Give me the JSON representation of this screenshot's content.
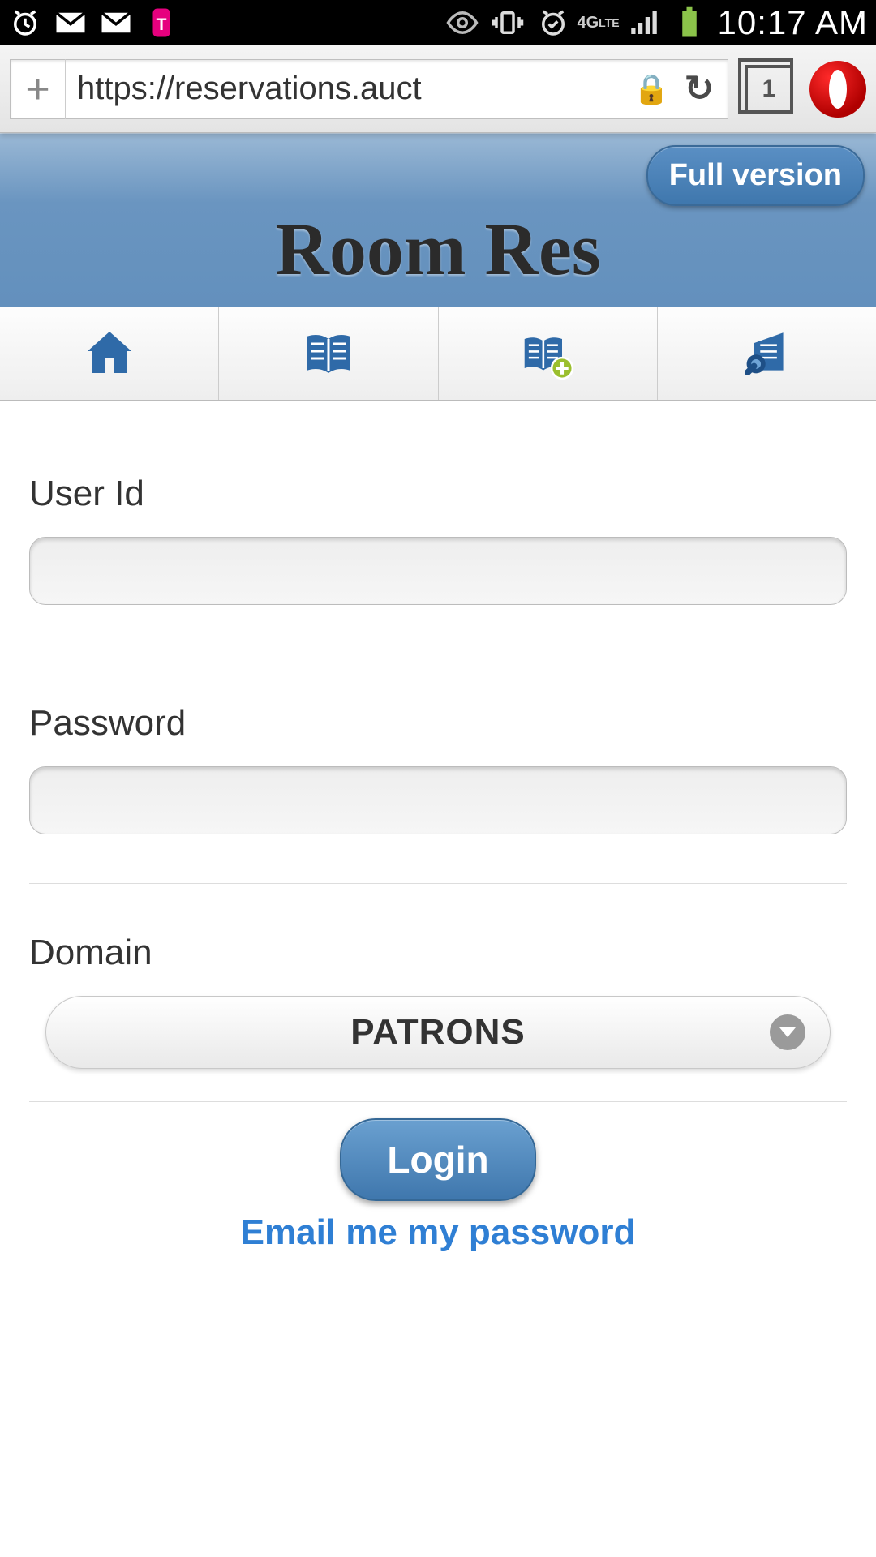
{
  "status_bar": {
    "time": "10:17 AM",
    "tab_count": "1",
    "icons_left": [
      "alarm",
      "gmail",
      "gmail",
      "tmobile"
    ],
    "icons_right": [
      "eye",
      "mute",
      "alarm-check",
      "4g-lte",
      "signal",
      "battery"
    ]
  },
  "browser": {
    "url": "https://reservations.auct",
    "new_tab_glyph": "+",
    "lock_glyph": "🔒",
    "reload_glyph": "↻"
  },
  "header": {
    "title": "Room Res",
    "full_version_label": "Full version"
  },
  "tabs": {
    "items": [
      "home",
      "reservations",
      "new-reservation",
      "search-rooms"
    ]
  },
  "form": {
    "user_id_label": "User Id",
    "user_id_value": "",
    "password_label": "Password",
    "password_value": "",
    "domain_label": "Domain",
    "domain_value": "PATRONS",
    "login_label": "Login",
    "email_link_label": "Email me my password"
  }
}
